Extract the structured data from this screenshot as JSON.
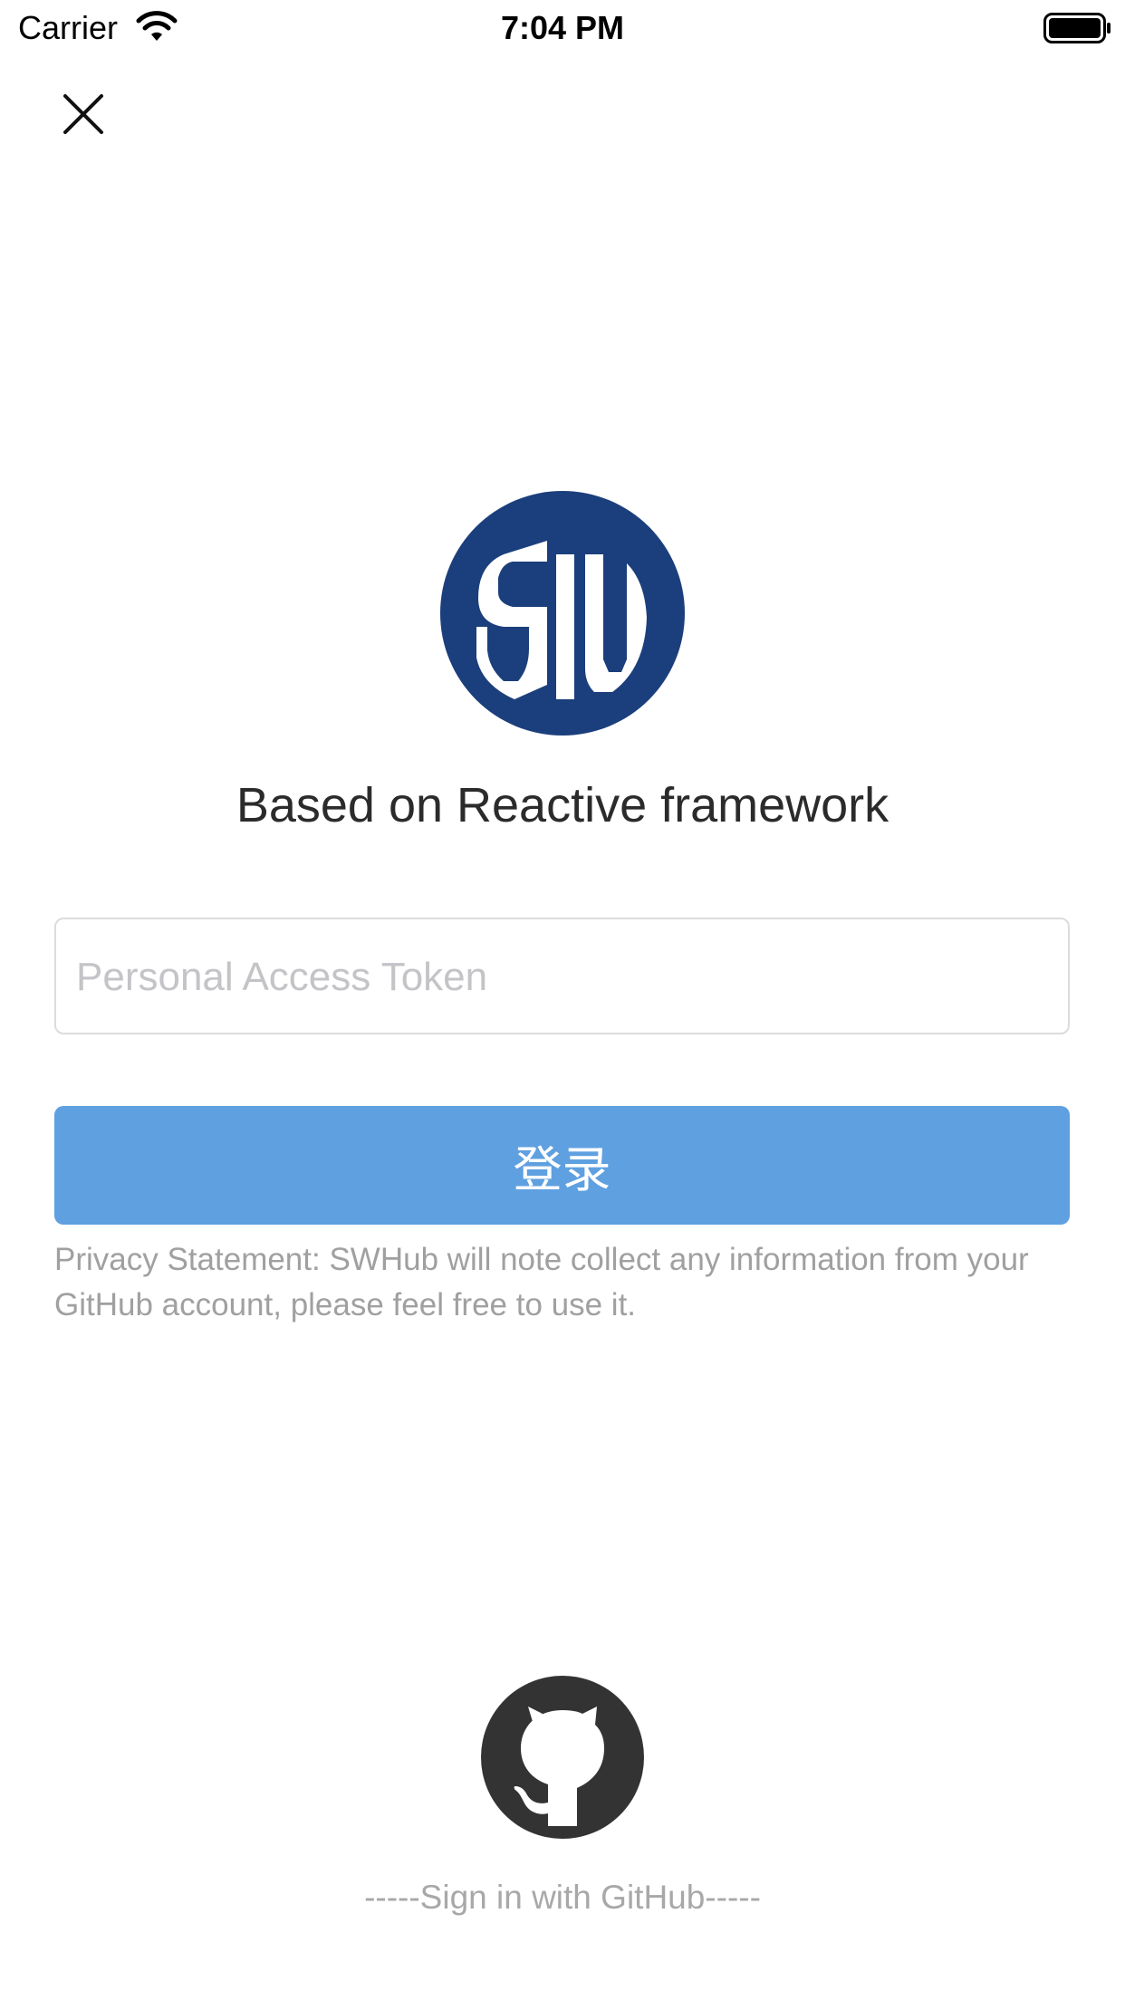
{
  "status_bar": {
    "carrier": "Carrier",
    "time": "7:04 PM"
  },
  "login": {
    "tagline": "Based on Reactive framework",
    "token_placeholder": "Personal Access Token",
    "token_value": "",
    "login_label": "登录",
    "privacy": "Privacy Statement: SWHub will note collect any information from your GitHub account, please feel free to use it.",
    "github_label": "-----Sign in with GitHub-----"
  },
  "logo": {
    "text": "SW",
    "circle_color": "#1b3f7c",
    "letter_color": "#ffffff"
  },
  "colors": {
    "primary_button": "#5fa0e0",
    "github_icon_bg": "#333333",
    "muted_text": "#a0a0a0"
  },
  "icons": {
    "close": "close-icon",
    "github": "github-icon",
    "wifi": "wifi-icon",
    "battery": "battery-icon"
  }
}
